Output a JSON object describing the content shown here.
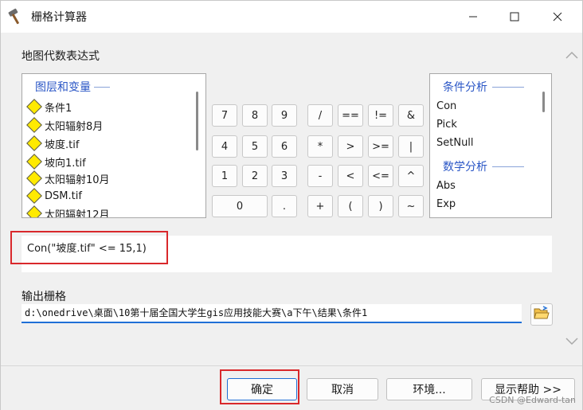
{
  "window": {
    "title": "栅格计算器",
    "minimize_icon": "minimize-icon",
    "maximize_icon": "maximize-icon",
    "close_icon": "close-icon"
  },
  "expression_section": {
    "label": "地图代数表达式"
  },
  "layers_panel": {
    "header": "图层和变量",
    "items": [
      {
        "label": "条件1",
        "icon": "raster-layer-icon",
        "color": "#ffea00"
      },
      {
        "label": "太阳辐射8月",
        "icon": "raster-layer-icon",
        "color": "#ffea00"
      },
      {
        "label": "坡度.tif",
        "icon": "raster-layer-icon",
        "color": "#ffea00"
      },
      {
        "label": "坡向1.tif",
        "icon": "raster-layer-icon",
        "color": "#ffea00"
      },
      {
        "label": "太阳辐射10月",
        "icon": "raster-layer-icon",
        "color": "#ffea00"
      },
      {
        "label": "DSM.tif",
        "icon": "raster-layer-icon",
        "color": "#ffea00"
      },
      {
        "label": "太阳辐射12月",
        "icon": "raster-layer-icon",
        "color": "#ffea00"
      }
    ]
  },
  "keypad": {
    "rows": [
      [
        "7",
        "8",
        "9",
        "/",
        "==",
        "!=",
        "&"
      ],
      [
        "4",
        "5",
        "6",
        "*",
        ">",
        ">=",
        "|"
      ],
      [
        "1",
        "2",
        "3",
        "-",
        "<",
        "<=",
        "^"
      ],
      [
        "0",
        ".",
        "+",
        "(",
        ")",
        "~"
      ]
    ]
  },
  "functions_panel": {
    "groups": [
      {
        "header": "条件分析",
        "items": [
          "Con",
          "Pick",
          "SetNull"
        ]
      },
      {
        "header": "数学分析",
        "items": [
          "Abs",
          "Exp"
        ]
      }
    ]
  },
  "expression": {
    "value": "Con(\"坡度.tif\" <= 15,1)"
  },
  "output": {
    "label": "输出栅格",
    "value": "d:\\onedrive\\桌面\\10第十届全国大学生gis应用技能大赛\\a下午\\结果\\条件1",
    "browse_icon": "folder-open-icon"
  },
  "buttons": {
    "ok": "确定",
    "cancel": "取消",
    "environments": "环境...",
    "show_help": "显示帮助 >>"
  },
  "watermark": "CSDN @Edward-tan",
  "colors": {
    "accent": "#1f6fd6",
    "section_header": "#2a56c6",
    "highlight_box": "#d9282b",
    "layer_icon": "#ffea00"
  }
}
